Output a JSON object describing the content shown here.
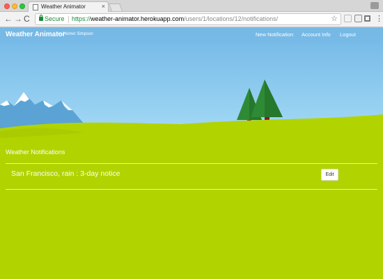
{
  "browser": {
    "tab_title": "Weather Animator",
    "tab_close": "×",
    "secure_label": "Secure",
    "url_scheme": "https://",
    "url_domain": "weather-animator.herokuapp.com",
    "url_path": "/users/1/locations/12/notifications/",
    "back_glyph": "←",
    "forward_glyph": "→",
    "reload_glyph": "C",
    "star_glyph": "☆",
    "menu_glyph": "⋮"
  },
  "navbar": {
    "brand": "Weather Animator",
    "user": ">> Homer Simpson",
    "links": [
      "New Notification",
      "Account Info",
      "Logout"
    ]
  },
  "main": {
    "heading": "Weather Notifications",
    "notifications": [
      {
        "text": "San Francisco, rain : 3-day notice",
        "button": "Edit"
      }
    ]
  },
  "colors": {
    "grass": "#b1d400",
    "sky_top": "#71b7e6",
    "sky_bottom": "#a6dbf6",
    "tree": "#2e8b35",
    "trunk": "#8b1a1a"
  }
}
